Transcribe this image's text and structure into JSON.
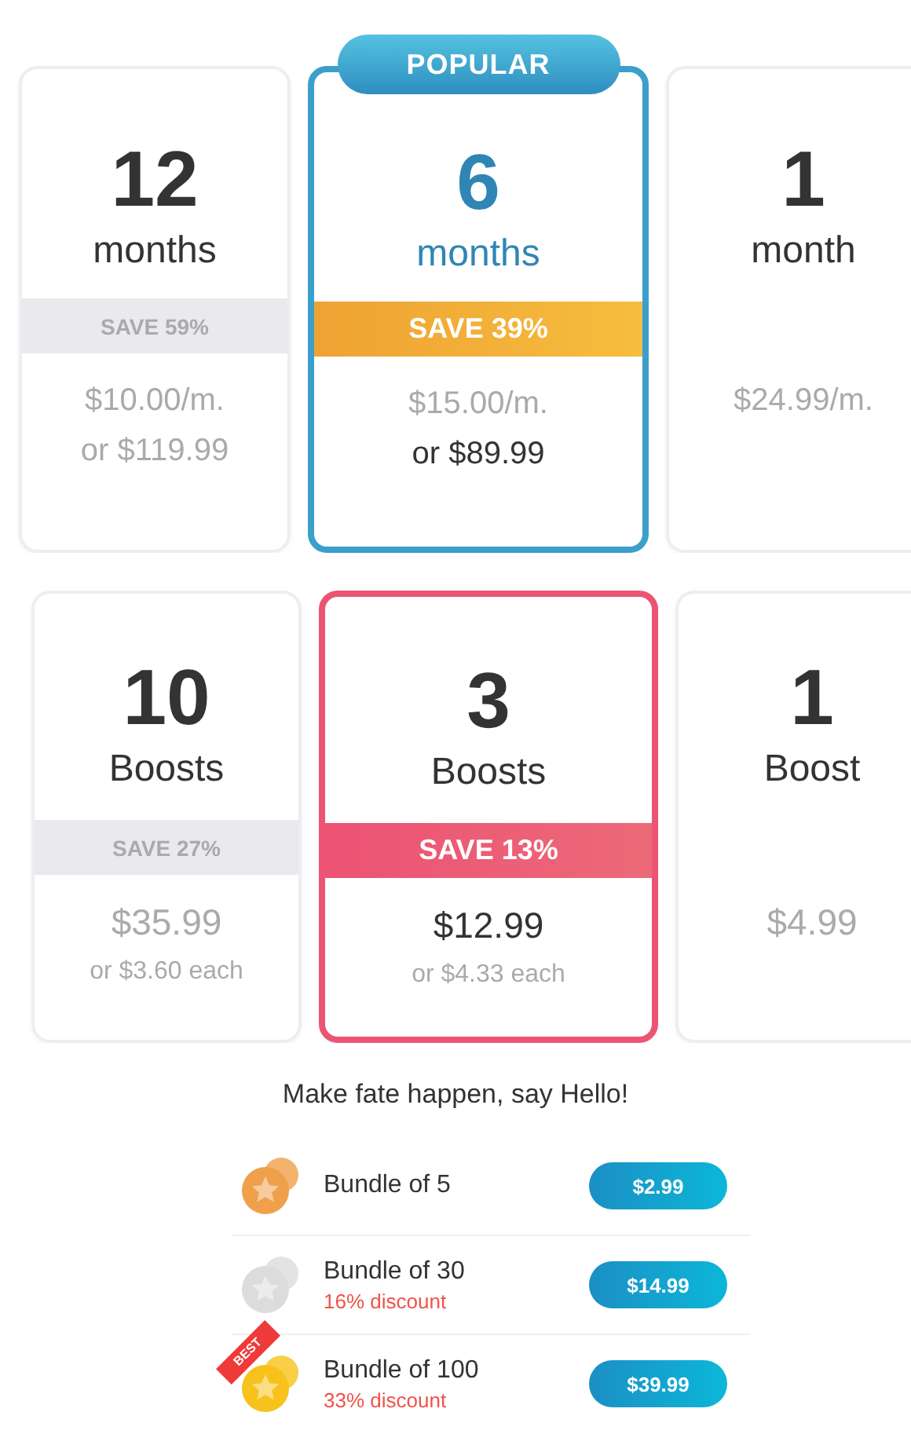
{
  "plan_sections": [
    {
      "kind": "subscription",
      "badge": "POPULAR",
      "plans": [
        {
          "number": "12",
          "unit": "months",
          "save": "SAVE 59%",
          "price": "$10.00/m.",
          "total": "or $119.99",
          "selected": false
        },
        {
          "number": "6",
          "unit": "months",
          "save": "SAVE 39%",
          "price": "$15.00/m.",
          "total": "or $89.99",
          "selected": true
        },
        {
          "number": "1",
          "unit": "month",
          "price": "$24.99/m.",
          "selected": false
        }
      ]
    },
    {
      "kind": "boosts",
      "plans": [
        {
          "number": "10",
          "unit": "Boosts",
          "save": "SAVE 27%",
          "price": "$35.99",
          "total": "or $3.60 each",
          "selected": false
        },
        {
          "number": "3",
          "unit": "Boosts",
          "save": "SAVE 13%",
          "price": "$12.99",
          "total": "or $4.33 each",
          "selected": true
        },
        {
          "number": "1",
          "unit": "Boost",
          "price": "$4.99",
          "selected": false
        }
      ]
    }
  ],
  "bundles": {
    "title": "Make fate happen, say Hello!",
    "items": [
      {
        "name": "Bundle of 5",
        "price": "$2.99",
        "color": "#f0a04b"
      },
      {
        "name": "Bundle of 30",
        "discount": "16% discount",
        "price": "$14.99",
        "color": "#dcdcdc"
      },
      {
        "name": "Bundle of 100",
        "discount": "33% discount",
        "price": "$39.99",
        "color": "#f7c21c",
        "ribbon": "BEST"
      }
    ]
  }
}
